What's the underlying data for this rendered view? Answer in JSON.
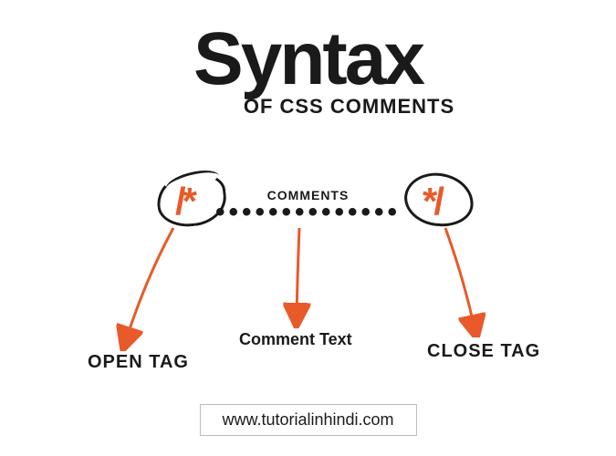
{
  "title": {
    "main": "Syntax",
    "sub": "OF CSS COMMENTS"
  },
  "syntax": {
    "open_symbol": "/*",
    "close_symbol": "*/",
    "dots": "••••••••••••••",
    "mid_label": "COMMENTS"
  },
  "labels": {
    "open": "OPEN TAG",
    "comment": "Comment Text",
    "close": "CLOSE TAG"
  },
  "footer": "www.tutorialinhindi.com",
  "colors": {
    "accent": "#e85a2a",
    "text": "#1a1a1a"
  }
}
